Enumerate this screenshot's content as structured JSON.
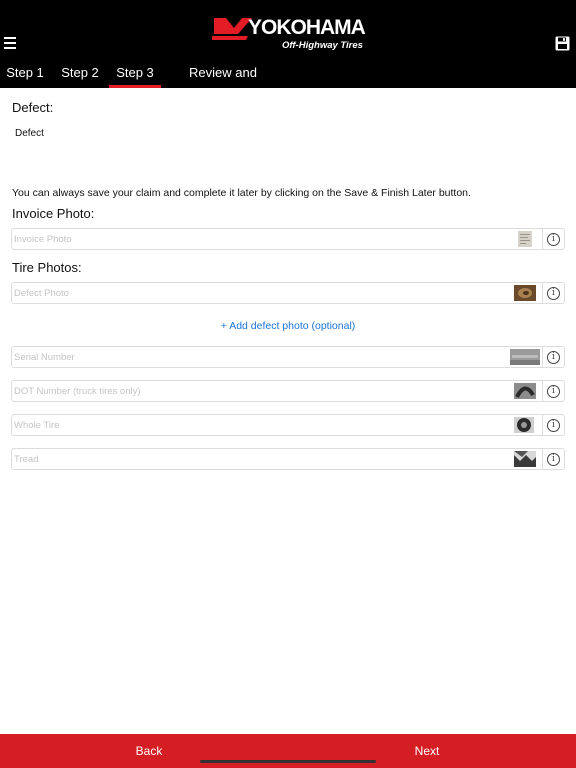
{
  "header": {
    "brand": "YOKOHAMA",
    "brand_sub": "Off-Highway Tires",
    "menu_icon": "hamburger-icon",
    "save_icon": "floppy-disk-icon"
  },
  "tabs": [
    {
      "label": "Step 1"
    },
    {
      "label": "Step 2"
    },
    {
      "label": "Step 3",
      "active": true
    },
    {
      "label": "Review and Submit"
    }
  ],
  "defect": {
    "label": "Defect:",
    "value": "Defect"
  },
  "save_note": "You can always save your claim and complete it later by clicking on the Save & Finish Later button.",
  "invoice": {
    "label": "Invoice Photo:",
    "placeholder": "Invoice Photo"
  },
  "tire_photos": {
    "label": "Tire Photos:",
    "defect_placeholder": "Defect Photo",
    "add_link": "+ Add defect photo (optional)",
    "serial_placeholder": "Serial Number",
    "dot_placeholder": "DOT Number (truck tires only)",
    "whole_tire_placeholder": "Whole Tire",
    "tread_placeholder": "Tread"
  },
  "footer": {
    "back_label": "Back",
    "next_label": "Next"
  },
  "colors": {
    "header_bg": "#000000",
    "accent_red": "#e31c25",
    "footer_bg": "#d51e24",
    "link_blue": "#1a73d9"
  }
}
